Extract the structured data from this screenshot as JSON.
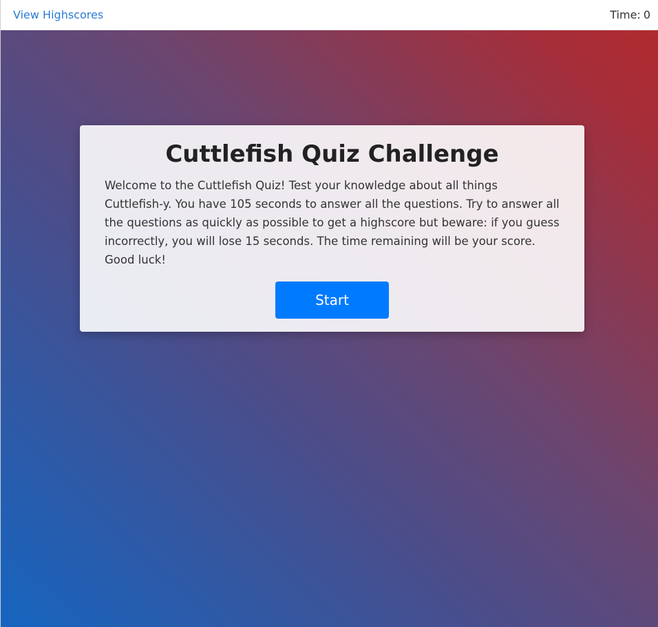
{
  "header": {
    "highscores_link": "View Highscores",
    "time_label": "Time:",
    "time_value": "0"
  },
  "card": {
    "title": "Cuttlefish Quiz Challenge",
    "description": "Welcome to the Cuttlefish Quiz! Test your knowledge about all things Cuttlefish-y. You have 105 seconds to answer all the questions. Try to answer all the questions as quickly as possible to get a highscore but beware: if you guess incorrectly, you will lose 15 seconds. The time remaining will be your score. Good luck!",
    "start_label": "Start"
  },
  "colors": {
    "link": "#2b7bd4",
    "button": "#007bff",
    "gradient_bottom_left": "#1565c0",
    "gradient_top_right": "#b32a2c"
  }
}
